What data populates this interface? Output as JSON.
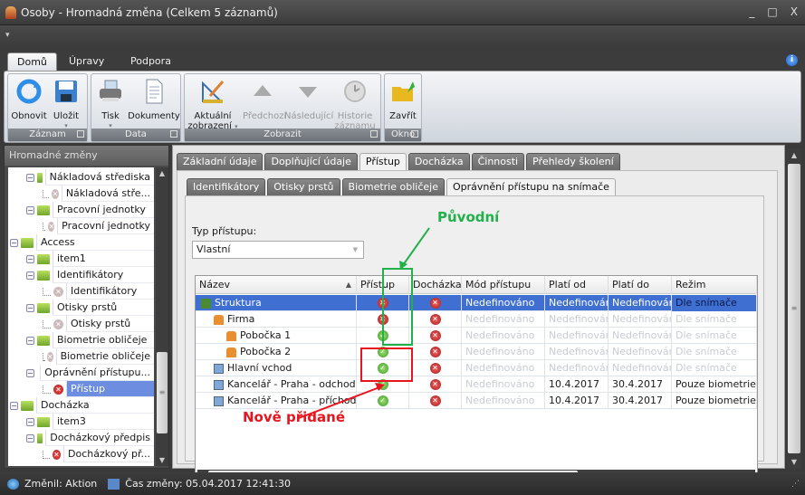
{
  "window": {
    "title": "Osoby - Hromadná změna (Celkem 5 záznamů)",
    "controls": [
      "_",
      "□",
      "X"
    ]
  },
  "ribbon": {
    "tabs": [
      "Domů",
      "Úpravy",
      "Podpora"
    ],
    "active_tab": "Domů",
    "groups": [
      {
        "label": "Záznam",
        "buttons": [
          {
            "label": "Obnovit",
            "icon": "refresh-icon"
          },
          {
            "label": "Uložit",
            "icon": "save-icon"
          }
        ]
      },
      {
        "label": "Data",
        "buttons": [
          {
            "label": "Tisk",
            "icon": "print-icon"
          },
          {
            "label": "Dokumenty",
            "icon": "document-icon"
          }
        ]
      },
      {
        "label": "Zobrazit",
        "buttons": [
          {
            "label": "Aktuální zobrazení",
            "icon": "view-icon"
          },
          {
            "label": "Předchozí",
            "icon": "up-arrow-icon",
            "disabled": true
          },
          {
            "label": "Následující",
            "icon": "down-arrow-icon",
            "disabled": true
          },
          {
            "label": "Historie záznamu",
            "icon": "history-icon",
            "disabled": true
          }
        ]
      },
      {
        "label": "Okno",
        "buttons": [
          {
            "label": "Zavřít",
            "icon": "close-folder-icon"
          }
        ]
      }
    ]
  },
  "sidebar": {
    "title": "Hromadné změny",
    "tree": [
      {
        "label": "Nákladová střediska",
        "level": 2,
        "type": "folder"
      },
      {
        "label": "Nákladová stře...",
        "level": 3,
        "type": "gray-x"
      },
      {
        "label": "Pracovní jednotky",
        "level": 2,
        "type": "folder"
      },
      {
        "label": "Pracovní jednotky",
        "level": 3,
        "type": "gray-x"
      },
      {
        "label": "Access",
        "level": 1,
        "type": "folder"
      },
      {
        "label": "item1",
        "level": 2,
        "type": "folder"
      },
      {
        "label": "Identifikátory",
        "level": 2,
        "type": "folder"
      },
      {
        "label": "Identifikátory",
        "level": 3,
        "type": "gray-x"
      },
      {
        "label": "Otisky prstů",
        "level": 2,
        "type": "folder"
      },
      {
        "label": "Otisky prstů",
        "level": 3,
        "type": "gray-x"
      },
      {
        "label": "Biometrie obličeje",
        "level": 2,
        "type": "folder"
      },
      {
        "label": "Biometrie obličeje",
        "level": 3,
        "type": "gray-x"
      },
      {
        "label": "Oprávnění přístupu...",
        "level": 2,
        "type": "folder"
      },
      {
        "label": "Přístup",
        "level": 3,
        "type": "red-x",
        "selected": true
      },
      {
        "label": "Docházka",
        "level": 1,
        "type": "folder"
      },
      {
        "label": "item3",
        "level": 2,
        "type": "folder"
      },
      {
        "label": "Docházkový předpis",
        "level": 2,
        "type": "folder"
      },
      {
        "label": "Docházkový př...",
        "level": 3,
        "type": "red-x"
      }
    ]
  },
  "main": {
    "tabs": [
      "Základní údaje",
      "Doplňující údaje",
      "Přístup",
      "Docházka",
      "Činnosti",
      "Přehledy školení"
    ],
    "active_tab": "Přístup",
    "subtabs": [
      "Identifikátory",
      "Otisky prstů",
      "Biometrie obličeje",
      "Oprávnění přístupu na snímače"
    ],
    "active_subtab": "Oprávnění přístupu na snímače",
    "access_type_label": "Typ přístupu:",
    "access_type_value": "Vlastní",
    "grid": {
      "columns": [
        "Název",
        "Přístup",
        "Docházka",
        "Mód přístupu",
        "Platí od",
        "Platí do",
        "Režim identifikace"
      ],
      "rows": [
        {
          "name": "Struktura",
          "icon": "structure-icon",
          "indent": 0,
          "access": "no",
          "attendance": "no",
          "mode": "Nedefinováno",
          "from": "Nedefinováno",
          "to": "Nedefinováno",
          "ident": "Dle snímače",
          "selected": true
        },
        {
          "name": "Firma",
          "icon": "house-icon",
          "indent": 1,
          "access": "no",
          "attendance": "no",
          "mode": "Nedefinováno",
          "from": "Nedefinováno",
          "to": "Nedefinováno",
          "ident": "Dle snímače"
        },
        {
          "name": "Pobočka 1",
          "icon": "house-icon",
          "indent": 2,
          "access": "ok",
          "attendance": "no",
          "mode": "Nedefinováno",
          "from": "Nedefinováno",
          "to": "Nedefinováno",
          "ident": "Dle snímače"
        },
        {
          "name": "Pobočka 2",
          "icon": "house-icon",
          "indent": 2,
          "access": "ok",
          "attendance": "no",
          "mode": "Nedefinováno",
          "from": "Nedefinováno",
          "to": "Nedefinováno",
          "ident": "Dle snímače"
        },
        {
          "name": "Hlavní vchod",
          "icon": "reader-icon",
          "indent": 1,
          "access": "ok",
          "attendance": "no",
          "mode": "Nedefinováno",
          "from": "Nedefinováno",
          "to": "Nedefinováno",
          "ident": "Dle snímače"
        },
        {
          "name": "Kancelář - Praha - odchod",
          "icon": "reader-icon",
          "indent": 1,
          "access": "ok",
          "attendance": "no",
          "mode": "Nedefinováno",
          "from": "10.4.2017",
          "to": "30.4.2017",
          "ident": "Pouze biometrie"
        },
        {
          "name": "Kancelář - Praha - příchod",
          "icon": "reader-icon",
          "indent": 1,
          "access": "ok",
          "attendance": "no",
          "mode": "Nedefinováno",
          "from": "10.4.2017",
          "to": "30.4.2017",
          "ident": "Pouze biometrie"
        }
      ]
    }
  },
  "annotations": {
    "original": "Původní",
    "new": "Nově přidané",
    "green": "#22b04a",
    "red": "#e8141e"
  },
  "status": {
    "changed_by": "Změnil: Aktion",
    "changed_at": "Čas změny: 05.04.2017 12:41:30"
  }
}
